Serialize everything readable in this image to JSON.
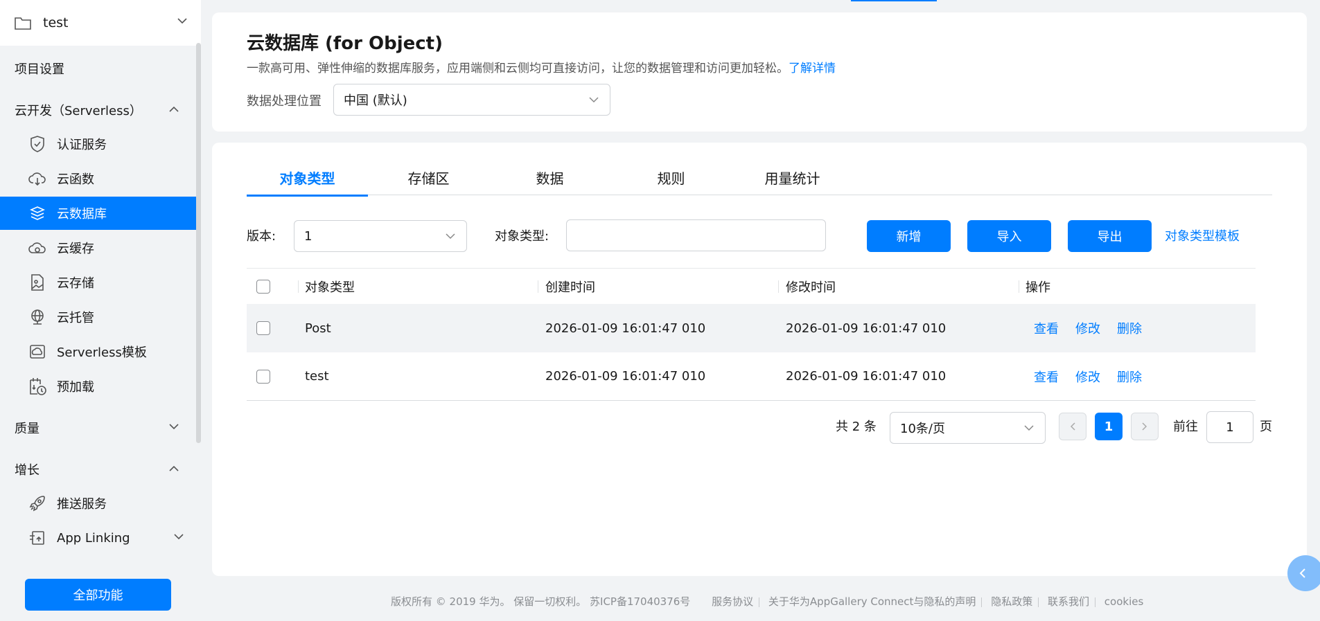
{
  "sidebar": {
    "project_name": "test",
    "items": {
      "project_settings": "项目设置",
      "serverless": "云开发（Serverless）",
      "auth": "认证服务",
      "functions": "云函数",
      "database": "云数据库",
      "cache": "云缓存",
      "storage": "云存储",
      "hosting": "云托管",
      "templates": "Serverless模板",
      "preload": "预加载",
      "quality": "质量",
      "growth": "增长",
      "push": "推送服务",
      "app_linking": "App Linking"
    },
    "all_functions": "全部功能"
  },
  "header": {
    "title": "云数据库 (for Object)",
    "description": "一款高可用、弹性伸缩的数据库服务，应用端侧和云侧均可直接访问，让您的数据管理和访问更加轻松。",
    "learn_more": "了解详情",
    "location_label": "数据处理位置",
    "location_value": "中国 (默认)"
  },
  "tabs": [
    "对象类型",
    "存储区",
    "数据",
    "规则",
    "用量统计"
  ],
  "filters": {
    "version_label": "版本:",
    "version_value": "1",
    "object_type_label": "对象类型:",
    "object_type_value": "",
    "add_button": "新增",
    "import_button": "导入",
    "export_button": "导出",
    "template_link": "对象类型模板"
  },
  "table": {
    "columns": [
      "对象类型",
      "创建时间",
      "修改时间",
      "操作"
    ],
    "rows": [
      {
        "name": "Post",
        "created": "2026-01-09 16:01:47 010",
        "modified": "2026-01-09 16:01:47 010"
      },
      {
        "name": "test",
        "created": "2026-01-09 16:01:47 010",
        "modified": "2026-01-09 16:01:47 010"
      }
    ],
    "actions": {
      "view": "查看",
      "edit": "修改",
      "delete": "删除"
    }
  },
  "pagination": {
    "total": "共 2 条",
    "page_size": "10条/页",
    "current_page": "1",
    "goto_label": "前往",
    "goto_value": "1",
    "page_suffix": "页"
  },
  "footer": {
    "copyright": "版权所有 © 2019 华为。 保留一切权利。 苏ICP备17040376号",
    "links": [
      "服务协议",
      "关于华为AppGallery Connect与隐私的声明",
      "隐私政策",
      "联系我们",
      "cookies"
    ]
  },
  "colors": {
    "accent": "#007dff",
    "background": "#f1f3f5"
  }
}
